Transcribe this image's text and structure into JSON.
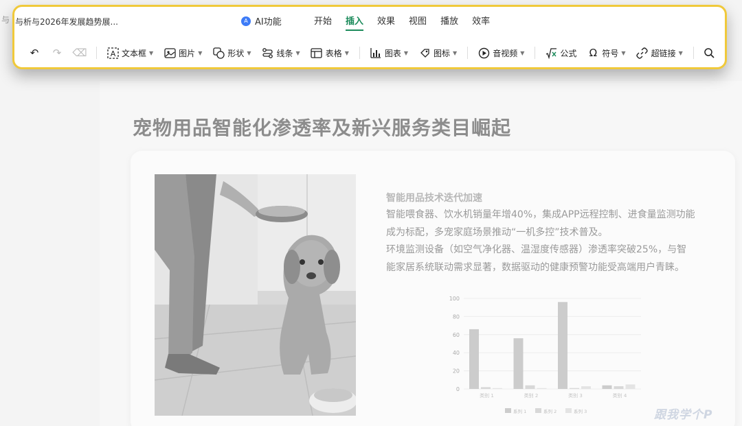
{
  "header": {
    "doc_title": "与析与2026年发展趋势展...",
    "ai_label": "AI功能",
    "ai_icon": "ai-logo-icon",
    "tabs": [
      {
        "label": "开始"
      },
      {
        "label": "插入",
        "active": true
      },
      {
        "label": "效果"
      },
      {
        "label": "视图"
      },
      {
        "label": "播放"
      },
      {
        "label": "效率"
      }
    ]
  },
  "toolbar": {
    "textbox_label": "文本框",
    "picture_label": "图片",
    "shape_label": "形状",
    "line_label": "线条",
    "table_label": "表格",
    "chart_label": "图表",
    "icon_label": "图标",
    "media_label": "音视频",
    "formula_label": "公式",
    "symbol_label": "符号",
    "hyperlink_label": "超链接"
  },
  "slide": {
    "title": "宠物用品智能化渗透率及新兴服务类目崛起",
    "section_heading": "智能用品技术迭代加速",
    "paragraph1": "智能喂食器、饮水机销量年增40%，集成APP远程控制、进食量监测功能成为标配，多宠家庭场景推动“一机多控”技术普及。",
    "paragraph2": "环境监测设备（如空气净化器、温湿度传感器）渗透率突破25%，与智能家居系统联动需求显著，数据驱动的健康预警功能受高端用户青睐。",
    "watermark": "跟我学个P"
  },
  "chart_data": {
    "type": "bar",
    "categories": [
      "类别 1",
      "类别 2",
      "类别 3",
      "类别 4"
    ],
    "series": [
      {
        "name": "系列 1",
        "values": [
          66,
          56,
          96,
          4
        ]
      },
      {
        "name": "系列 2",
        "values": [
          2,
          4,
          1,
          3
        ]
      },
      {
        "name": "系列 3",
        "values": [
          1,
          1,
          3,
          5
        ]
      }
    ],
    "yticks": [
      "0",
      "20",
      "40",
      "60",
      "80",
      "100"
    ],
    "ylim": [
      0,
      100
    ],
    "legend": "bottom",
    "colors": [
      "#cccccc",
      "#d8d8d8",
      "#e4e4e4"
    ]
  },
  "colors": {
    "accent": "#1a8a5a",
    "highlight_border": "#f0c93a",
    "ai_blue": "#3d7bf7"
  }
}
